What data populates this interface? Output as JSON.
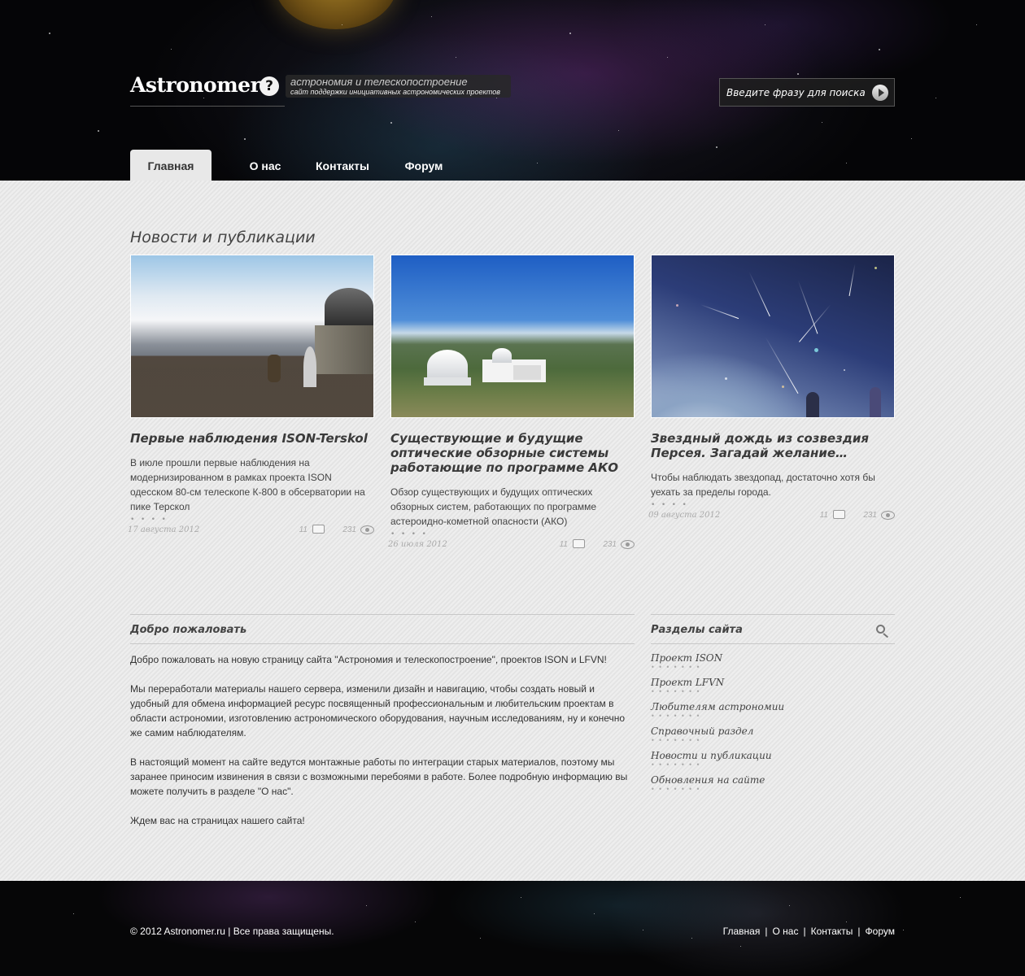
{
  "header": {
    "logo_text": "Astronomer",
    "logo_mark": "?",
    "tagline_main": "астрономия и телескопостроение",
    "tagline_sub": "сайт поддержки инициативных астрономических проектов",
    "search_placeholder": "Введите фразу для поиска",
    "nav": [
      {
        "label": "Главная",
        "active": true
      },
      {
        "label": "О нас"
      },
      {
        "label": "Контакты"
      },
      {
        "label": "Форум"
      }
    ]
  },
  "news": {
    "title": "Новости и публикации",
    "items": [
      {
        "title": "Первые наблюдения ISON-Terskol",
        "text": "В июле прошли первые наблюдения на модернизированном в рамках проекта ISON одесском 80-см телескопе К-800 в обсерватории на пике Терскол",
        "date": "17 августа 2012",
        "comments": "11",
        "views": "231"
      },
      {
        "title": "Существующие и будущие оптические обзорные системы работающие по программе АКО",
        "text": "Обзор существующих и будущих оптических обзорных систем, работающих по программе астероидно-кометной опасности (АКО)",
        "date": "26 июля 2012",
        "comments": "11",
        "views": "231"
      },
      {
        "title": "Звездный дождь из созвездия Персея. Загадай желание…",
        "text": "Чтобы наблюдать звездопад, достаточно хотя бы уехать за пределы города.",
        "date": "09 августа 2012",
        "comments": "11",
        "views": "231"
      }
    ]
  },
  "welcome": {
    "title": "Добро пожаловать",
    "paragraphs": [
      "Добро пожаловать на новую страницу сайта \"Астрономия и телескопостроение\", проектов ISON и LFVN!",
      "Мы переработали материалы нашего сервера, изменили дизайн и навигацию, чтобы создать новый и удобный для обмена информацией ресурс посвященный профессиональным и любительским проектам в области астрономии, изготовлению астрономического оборудования,  научным исследованиям, ну и конечно же самим наблюдателям.",
      "В настоящий момент на сайте ведутся монтажные работы по интеграции старых материалов, поэтому мы заранее приносим извинения в связи с возможными перебоями в работе. Более подробную информацию вы можете получить в разделе \"О нас\".",
      "Ждем вас на страницах нашего сайта!"
    ]
  },
  "sections": {
    "title": "Разделы сайта",
    "links": [
      "Проект ISON",
      "Проект LFVN",
      "Любителям астрономии",
      "Справочный раздел",
      "Новости и публикации",
      "Обновления на сайте"
    ]
  },
  "footer": {
    "copyright": "© 2012 Astronomer.ru | Все права защищены.",
    "nav": [
      "Главная",
      "О нас",
      "Контакты",
      "Форум"
    ],
    "separator": "|"
  },
  "colors": {
    "header_bg": "#050507",
    "content_bg": "#e9e9e9",
    "active_tab": "#e8e8e8",
    "footer_bg": "#060607"
  }
}
